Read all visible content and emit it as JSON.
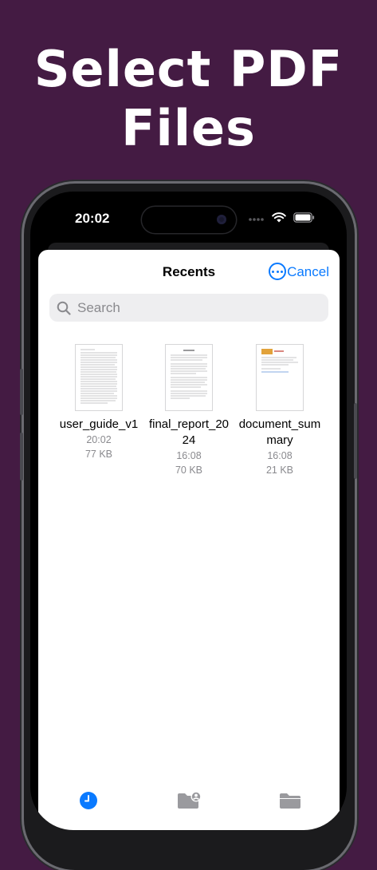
{
  "headline": {
    "line1": "Select PDF",
    "line2": "Files"
  },
  "status_bar": {
    "time": "20:02"
  },
  "picker": {
    "title": "Recents",
    "cancel_label": "Cancel",
    "more_icon": "ellipsis-circle-icon",
    "search": {
      "placeholder": "Search",
      "icon": "magnifier-icon"
    }
  },
  "files": [
    {
      "name": "user_guide_v1",
      "time": "20:02",
      "size": "77 KB"
    },
    {
      "name": "final_report_2024",
      "time": "16:08",
      "size": "70 KB"
    },
    {
      "name": "document_summary",
      "time": "16:08",
      "size": "21 KB"
    }
  ],
  "tabs": [
    {
      "icon": "clock-icon",
      "active": true
    },
    {
      "icon": "shared-folder-icon",
      "active": false
    },
    {
      "icon": "folder-icon",
      "active": false
    }
  ],
  "colors": {
    "background": "#441b43",
    "accent": "#0a7aff",
    "secondary_text": "#8a8a8e"
  }
}
